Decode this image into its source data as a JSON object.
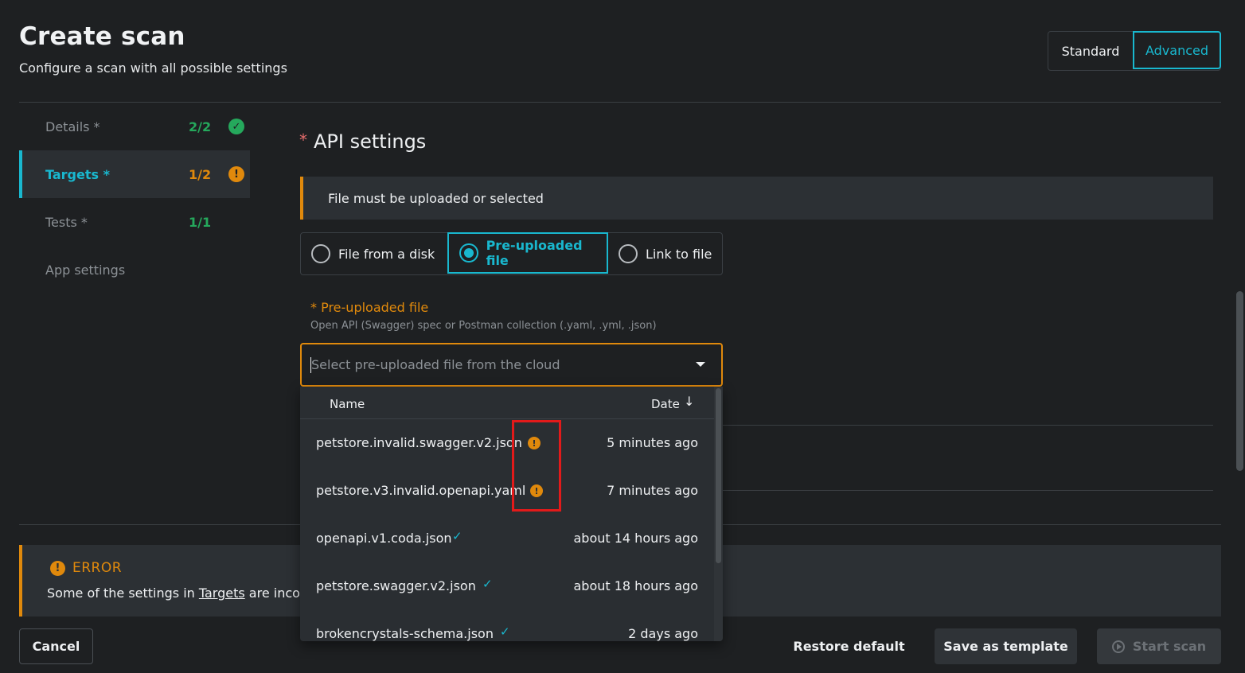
{
  "header": {
    "title": "Create scan",
    "subtitle": "Configure a scan with all possible settings",
    "mode_standard": "Standard",
    "mode_advanced": "Advanced",
    "active_mode": "Advanced"
  },
  "sidebar": {
    "items": [
      {
        "label": "Details *",
        "count": "2/2",
        "status": "complete"
      },
      {
        "label": "Targets *",
        "count": "1/2",
        "status": "warning"
      },
      {
        "label": "Tests *",
        "count": "1/1",
        "status": "none"
      },
      {
        "label": "App settings",
        "count": "",
        "status": "none"
      }
    ],
    "active": "Targets *"
  },
  "api_settings": {
    "title": "API settings",
    "required_mark": "*",
    "warning": "File must be uploaded or selected",
    "source_options": [
      "File from a disk",
      "Pre-uploaded file",
      "Link to file"
    ],
    "selected_source": "Pre-uploaded file",
    "field_label": "* Pre-uploaded file",
    "field_hint": "Open API (Swagger) spec or Postman collection (.yaml, .yml, .json)",
    "select_placeholder": "Select pre-uploaded file from the cloud"
  },
  "file_dropdown": {
    "col_name": "Name",
    "col_date": "Date",
    "sort": "descending",
    "rows": [
      {
        "name": "petstore.invalid.swagger.v2.json",
        "date": "5 minutes ago",
        "status": "warning"
      },
      {
        "name": "petstore.v3.invalid.openapi.yaml",
        "date": "7 minutes ago",
        "status": "warning"
      },
      {
        "name": "openapi.v1.coda.json",
        "date": "about 14 hours ago",
        "status": "valid"
      },
      {
        "name": "petstore.swagger.v2.json",
        "date": "about 18 hours ago",
        "status": "valid"
      },
      {
        "name": "brokencrystals-schema.json",
        "date": "2 days ago",
        "status": "valid"
      }
    ]
  },
  "error_panel": {
    "title": "ERROR",
    "text_before": "Some of the settings in ",
    "link": "Targets",
    "text_after": " are inco"
  },
  "footer": {
    "cancel": "Cancel",
    "restore": "Restore default",
    "save_template": "Save as template",
    "start": "Start scan"
  },
  "colors": {
    "accent": "#19b8cf",
    "warning": "#e0890c",
    "success": "#25a85c",
    "highlight": "#e21a1a"
  }
}
